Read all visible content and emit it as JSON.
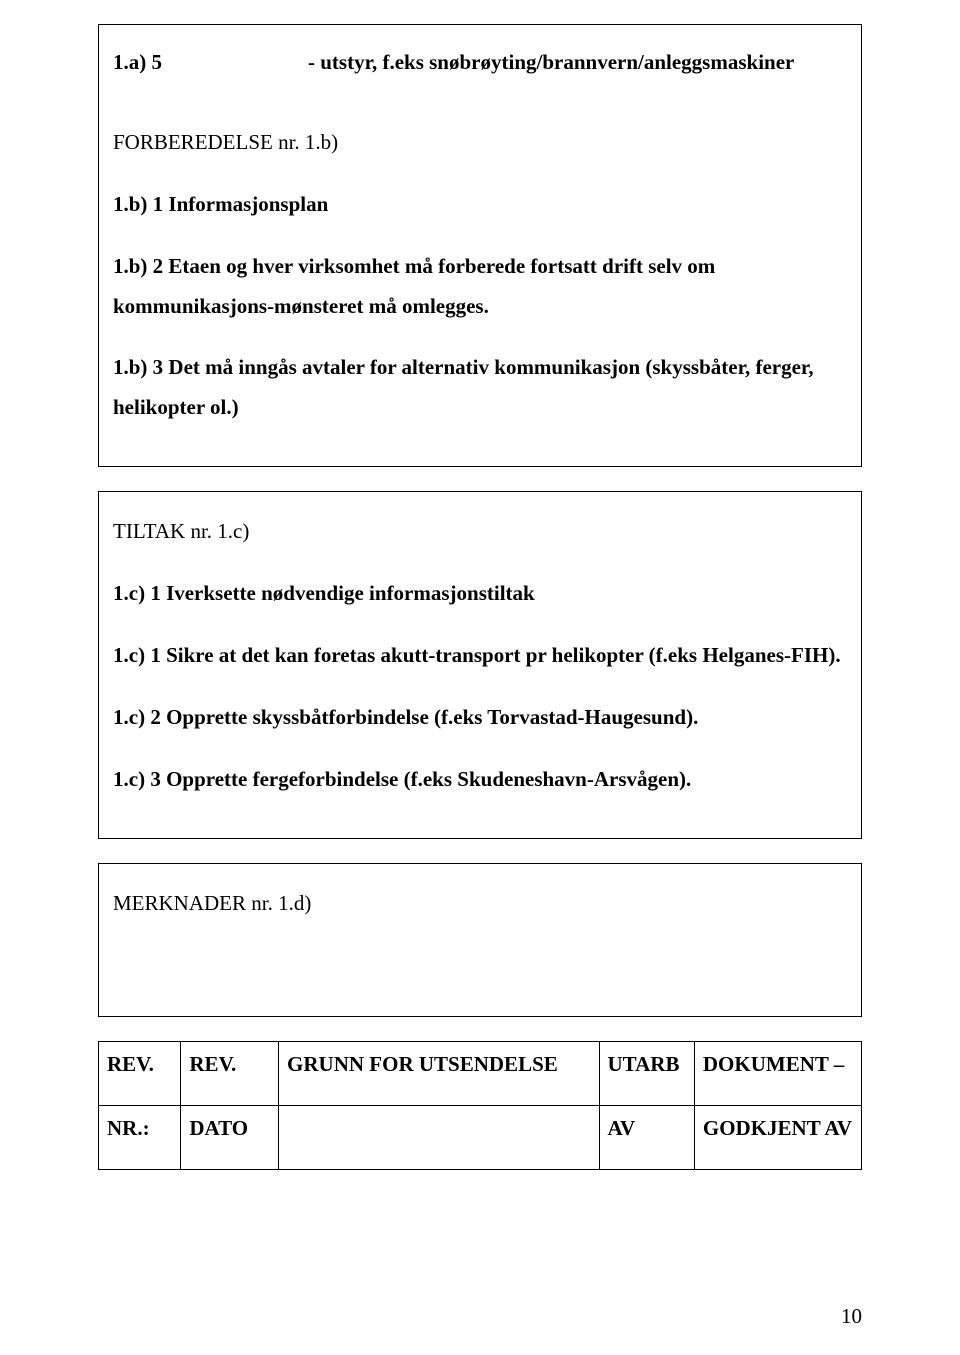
{
  "box1": {
    "line_1a_left": "1.a) 5",
    "line_1a_right": "- utstyr, f.eks snøbrøyting/brannvern/anleggsmaskiner",
    "title": "FORBEREDELSE  nr. 1.b)",
    "items": [
      "1.b) 1 Informasjonsplan",
      "1.b) 2 Etaen og hver virksomhet må forberede fortsatt drift selv om kommunikasjons-mønsteret må omlegges.",
      "1.b) 3 Det må inngås avtaler for alternativ kommunikasjon (skyssbåter, ferger, helikopter ol.)"
    ]
  },
  "box2": {
    "title": "TILTAK  nr. 1.c)",
    "items": [
      "1.c) 1 Iverksette nødvendige informasjonstiltak",
      "1.c) 1 Sikre at det kan foretas akutt-transport pr helikopter (f.eks Helganes-FIH).",
      "1.c) 2 Opprette skyssbåtforbindelse (f.eks Torvastad-Haugesund).",
      "1.c) 3 Opprette fergeforbindelse (f.eks Skudeneshavn-Arsvågen)."
    ]
  },
  "box3": {
    "title": "MERKNADER  nr. 1.d)"
  },
  "revTable": {
    "row1": {
      "nr": "REV.",
      "dato": "REV.",
      "grunn": "GRUNN FOR UTSENDELSE",
      "utarb": "UTARB",
      "dok": "DOKUMENT –"
    },
    "row2": {
      "nr": "NR.:",
      "dato": "DATO",
      "grunn": "",
      "utarb": "AV",
      "dok": "GODKJENT AV"
    }
  },
  "pageNumber": "10"
}
